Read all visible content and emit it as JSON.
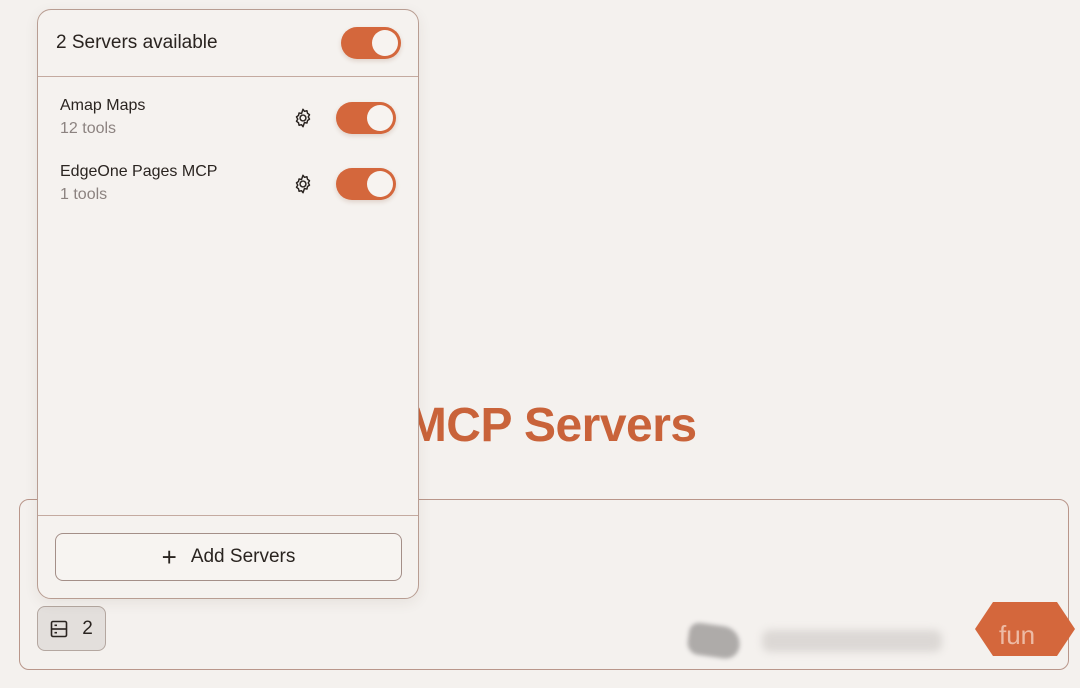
{
  "hero": {
    "heading": "with MCP Servers"
  },
  "popover": {
    "title": "2 Servers available",
    "master_toggle_on": true,
    "servers": [
      {
        "name": "Amap Maps",
        "tools": "12 tools",
        "enabled": true
      },
      {
        "name": "EdgeOne Pages MCP",
        "tools": "1 tools",
        "enabled": true
      }
    ],
    "add_button_label": "Add Servers",
    "add_icon": "plus-icon"
  },
  "composer": {
    "server_count": "2",
    "server_icon": "server-list-icon",
    "send_label": "fun"
  },
  "colors": {
    "accent": "#d4673c",
    "hero_text": "#c9633a",
    "background": "#f4f1ee"
  }
}
